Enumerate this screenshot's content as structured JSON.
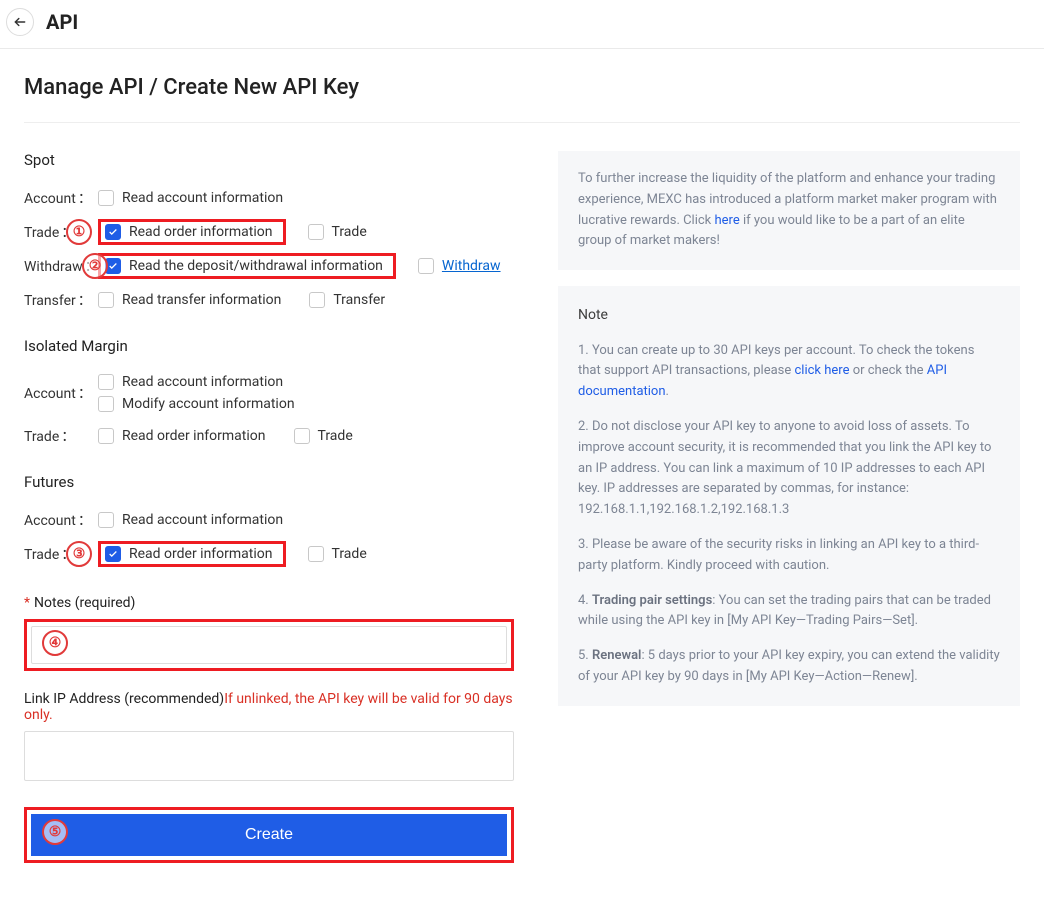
{
  "header": {
    "title": "API"
  },
  "breadcrumb": "Manage API / Create New API Key",
  "spot": {
    "title": "Spot",
    "account_label": "Account",
    "account_read": "Read account information",
    "trade_label": "Trade",
    "trade_read": "Read order information",
    "trade_do": "Trade",
    "withdraw_label": "Withdraw",
    "withdraw_read": "Read the deposit/withdrawal information",
    "withdraw_do": "Withdraw",
    "transfer_label": "Transfer",
    "transfer_read": "Read transfer information",
    "transfer_do": "Transfer"
  },
  "margin": {
    "title": "Isolated Margin",
    "account_label": "Account",
    "account_read": "Read account information",
    "account_modify": "Modify account information",
    "trade_label": "Trade",
    "trade_read": "Read order information",
    "trade_do": "Trade"
  },
  "futures": {
    "title": "Futures",
    "account_label": "Account",
    "account_read": "Read account information",
    "trade_label": "Trade",
    "trade_read": "Read order information",
    "trade_do": "Trade"
  },
  "notes": {
    "label": "Notes (required)"
  },
  "ip": {
    "label": "Link IP Address (recommended)",
    "hint": "If unlinked, the API key will be valid for 90 days only."
  },
  "create_label": "Create",
  "info": {
    "pre": "To further increase the liquidity of the platform and enhance your trading experience, MEXC has introduced a platform market maker program with lucrative rewards. Click ",
    "here": "here",
    "post": " if you would like to be a part of an elite group of market makers!"
  },
  "notes_panel": {
    "title": "Note",
    "n1a": "1. You can create up to 30 API keys per account. To check the tokens that support API transactions, please ",
    "n1_click": "click here",
    "n1b": " or check the ",
    "n1_doc": "API documentation",
    "n1c": ".",
    "n2": "2. Do not disclose your API key to anyone to avoid loss of assets. To improve account security, it is recommended that you link the API key to an IP address. You can link a maximum of 10 IP addresses to each API key. IP addresses are separated by commas, for instance: 192.168.1.1,192.168.1.2,192.168.1.3",
    "n3": "3. Please be aware of the security risks in linking an API key to a third-party platform. Kindly proceed with caution.",
    "n4a": "4. ",
    "n4_bold": "Trading pair settings",
    "n4b": ": You can set the trading pairs that can be traded while using the API key in [My API Key—Trading Pairs—Set].",
    "n5a": "5. ",
    "n5_bold": "Renewal",
    "n5b": ": 5 days prior to your API key expiry, you can extend the validity of your API key by 90 days in [My API Key—Action—Renew]."
  },
  "ann": {
    "a1": "①",
    "a2": "②",
    "a3": "③",
    "a4": "④",
    "a5": "⑤"
  }
}
